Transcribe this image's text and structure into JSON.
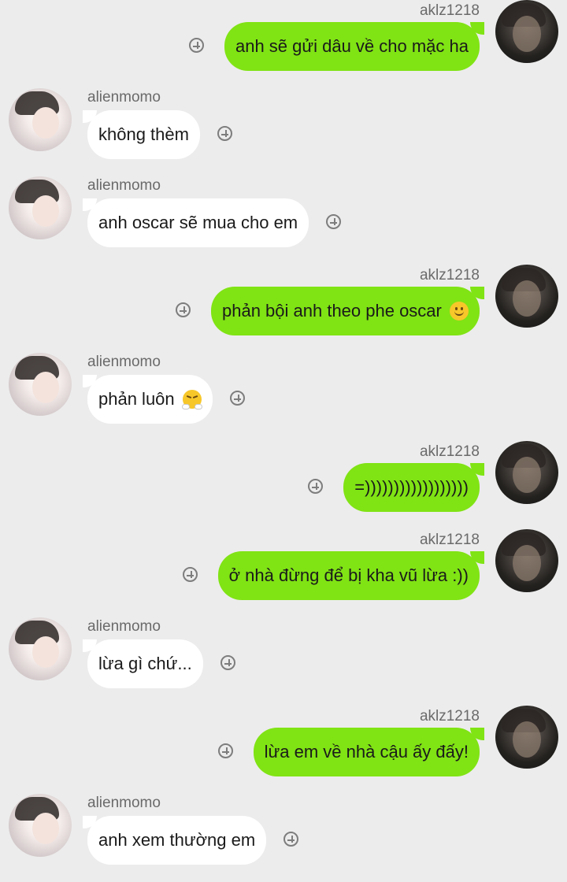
{
  "conversation": {
    "messages": [
      {
        "sender": "aklz1218",
        "direction": "outgoing",
        "text": "anh sẽ gửi dâu về cho mặc ha",
        "emoji": ""
      },
      {
        "sender": "alienmomo",
        "direction": "incoming",
        "text": "không thèm",
        "emoji": ""
      },
      {
        "sender": "alienmomo",
        "direction": "incoming",
        "text": "anh oscar sẽ mua cho em",
        "emoji": ""
      },
      {
        "sender": "aklz1218",
        "direction": "outgoing",
        "text": "phản bội anh theo phe oscar",
        "emoji": "slightly-smiling-face"
      },
      {
        "sender": "alienmomo",
        "direction": "incoming",
        "text": "phản luôn",
        "emoji": "face-with-steam-from-nose"
      },
      {
        "sender": "aklz1218",
        "direction": "outgoing",
        "text": "=))))))))))))))))))",
        "emoji": ""
      },
      {
        "sender": "aklz1218",
        "direction": "outgoing",
        "text": "ở nhà đừng để bị kha vũ lừa :))",
        "emoji": ""
      },
      {
        "sender": "alienmomo",
        "direction": "incoming",
        "text": "lừa gì chứ...",
        "emoji": ""
      },
      {
        "sender": "aklz1218",
        "direction": "outgoing",
        "text": "lừa em về nhà cậu ấy đấy!",
        "emoji": ""
      },
      {
        "sender": "alienmomo",
        "direction": "incoming",
        "text": "anh xem thường em",
        "emoji": ""
      }
    ]
  },
  "colors": {
    "background": "#ececec",
    "outgoing_bubble": "#80e314",
    "incoming_bubble": "#ffffff",
    "sender_name": "#6a6a6a",
    "add_icon": "#7d7d7d"
  },
  "icons": {
    "add": "circle-plus-icon",
    "avatar": "user-avatar"
  }
}
